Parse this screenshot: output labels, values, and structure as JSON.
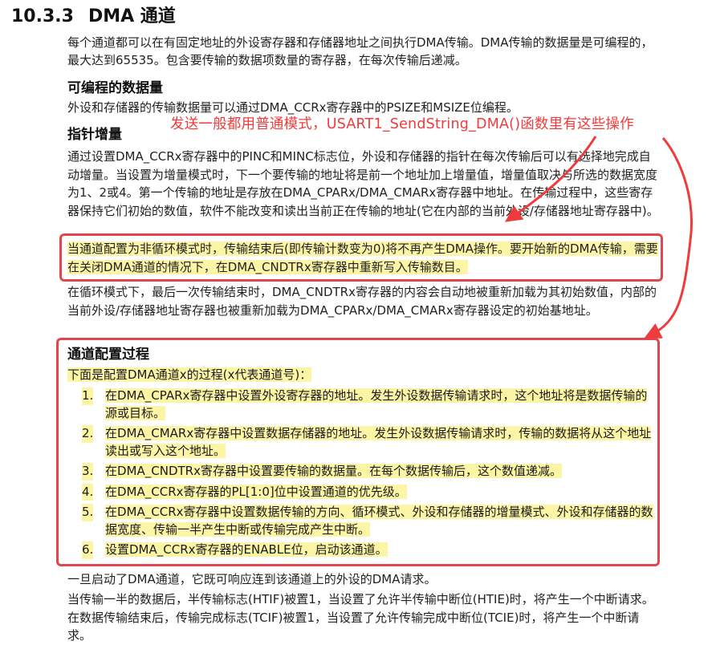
{
  "section": {
    "number": "10.3.3",
    "title": "DMA 通道"
  },
  "intro": "每个通道都可以在有固定地址的外设寄存器和存储器地址之间执行DMA传输。DMA传输的数据量是可编程的，最大达到65535。包含要传输的数据项数量的寄存器，在每次传输后递减。",
  "programmable": {
    "heading": "可编程的数据量",
    "text": "外设和存储器的传输数据量可以通过DMA_CCRx寄存器中的PSIZE和MSIZE位编程。"
  },
  "annotation": "发送一般都用普通模式，USART1_SendString_DMA()函数里有这些操作",
  "pointer": {
    "heading": "指针增量",
    "text": "通过设置DMA_CCRx寄存器中的PINC和MINC标志位，外设和存储器的指针在每次传输后可以有选择地完成自动增量。当设置为增量模式时，下一个要传输的地址将是前一个地址加上增量值，增量值取决与所选的数据宽度为1、2或4。第一个传输的地址是存放在DMA_CPARx/DMA_CMARx寄存器中地址。在传输过程中，这些寄存器保持它们初始的数值，软件不能改变和读出当前正在传输的地址(它在内部的当前外设/存储器地址寄存器中)。"
  },
  "noncircular": "当通道配置为非循环模式时，传输结束后(即传输计数变为0)将不再产生DMA操作。要开始新的DMA传输，需要在关闭DMA通道的情况下，在DMA_CNDTRx寄存器中重新写入传输数目。",
  "circular": "在循环模式下，最后一次传输结束时，DMA_CNDTRx寄存器的内容会自动地被重新加载为其初始数值，内部的当前外设/存储器地址寄存器也被重新加载为DMA_CPARx/DMA_CMARx寄存器设定的初始基地址。",
  "config": {
    "heading": "通道配置过程",
    "lead": "下面是配置DMA通道x的过程(x代表通道号)：",
    "steps": [
      {
        "n": "1.",
        "text": "在DMA_CPARx寄存器中设置外设寄存器的地址。发生外设数据传输请求时，这个地址将是数据传输的源或目标。"
      },
      {
        "n": "2.",
        "text": "在DMA_CMARx寄存器中设置数据存储器的地址。发生外设数据传输请求时，传输的数据将从这个地址读出或写入这个地址。"
      },
      {
        "n": "3.",
        "text": "在DMA_CNDTRx寄存器中设置要传输的数据量。在每个数据传输后，这个数值递减。"
      },
      {
        "n": "4.",
        "text": "在DMA_CCRx寄存器的PL[1:0]位中设置通道的优先级。"
      },
      {
        "n": "5.",
        "text": "在DMA_CCRx寄存器中设置数据传输的方向、循环模式、外设和存储器的增量模式、外设和存储器的数据宽度、传输一半产生中断或传输完成产生中断。"
      },
      {
        "n": "6.",
        "text": "设置DMA_CCRx寄存器的ENABLE位，启动该通道。"
      }
    ]
  },
  "after_start": "一旦启动了DMA通道，它既可响应连到该通道上的外设的DMA请求。",
  "interrupts": "当传输一半的数据后，半传输标志(HTIF)被置1，当设置了允许半传输中断位(HTIE)时，将产生一个中断请求。在数据传输结束后，传输完成标志(TCIF)被置1，当设置了允许传输完成中断位(TCIE)时，将产生一个中断请求。",
  "colors": {
    "highlight": "#fdf5a6",
    "annotation": "#ef3b3b",
    "box": "#e0474c"
  }
}
